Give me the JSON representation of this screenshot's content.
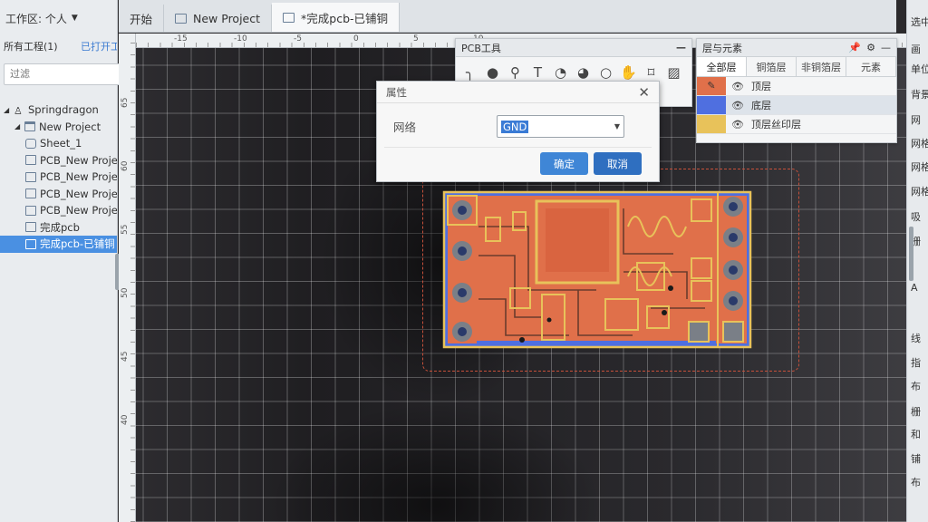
{
  "left_panel": {
    "workspace_label": "工作区: 个人",
    "projects_label": "所有工程(1)",
    "opened_label": "已打开工",
    "filter_placeholder": "过滤",
    "tree": [
      {
        "label": "Springdragon",
        "level": 0,
        "icon": "user-icon",
        "selected": false
      },
      {
        "label": "New Project",
        "level": 1,
        "icon": "folder-icon",
        "selected": false
      },
      {
        "label": "Sheet_1",
        "level": 2,
        "icon": "schematic-icon",
        "selected": false
      },
      {
        "label": "PCB_New Project",
        "level": 2,
        "icon": "pcb-icon",
        "selected": false
      },
      {
        "label": "PCB_New Project",
        "level": 2,
        "icon": "pcb-icon",
        "selected": false
      },
      {
        "label": "PCB_New Project",
        "level": 2,
        "icon": "pcb-icon",
        "selected": false
      },
      {
        "label": "PCB_New Project",
        "level": 2,
        "icon": "pcb-icon",
        "selected": false
      },
      {
        "label": "完成pcb",
        "level": 2,
        "icon": "pcb-icon",
        "selected": false
      },
      {
        "label": "完成pcb-已铺铜",
        "level": 2,
        "icon": "pcb-icon",
        "selected": true
      }
    ]
  },
  "tabs": [
    {
      "label": "开始",
      "icon": "",
      "active": false
    },
    {
      "label": "New Project",
      "icon": "folder-icon",
      "active": false
    },
    {
      "label": "*完成pcb-已铺铜",
      "icon": "pcb-icon",
      "active": true
    }
  ],
  "rulers": {
    "top": [
      "-15",
      "-10",
      "-5",
      "0",
      "5",
      "10"
    ],
    "left": [
      "65",
      "60",
      "55",
      "50",
      "45",
      "40"
    ]
  },
  "pcb_tools": {
    "title": "PCB工具",
    "minimize": "—",
    "tools": [
      "track-icon",
      "circle-pad-icon",
      "via-icon",
      "text-icon",
      "arc-icon",
      "arc2-icon",
      "circle-icon",
      "pan-icon",
      "measure-icon",
      "image-icon"
    ]
  },
  "layers_panel": {
    "title": "层与元素",
    "tabs": [
      "全部层",
      "铜箔层",
      "非铜箔层",
      "元素"
    ],
    "active_tab": 0,
    "layers": [
      {
        "name": "顶层",
        "color": "#e0704a",
        "selected": false
      },
      {
        "name": "底层",
        "color": "#4f6fe0",
        "selected": true
      },
      {
        "name": "顶层丝印层",
        "color": "#e8c25a",
        "selected": false
      }
    ]
  },
  "dialog": {
    "title": "属性",
    "field_label": "网络",
    "field_value": "GND",
    "ok_label": "确定",
    "cancel_label": "取消"
  },
  "right_panel": {
    "items": [
      "选中",
      "画",
      "单位",
      "背景",
      "网",
      "网格",
      "网格",
      "网格",
      "吸",
      "栅",
      "A",
      "线",
      "指",
      "布",
      "栅",
      "和",
      "铺",
      "布"
    ]
  },
  "colors": {
    "copper_top": "#e0704a",
    "copper_bottom": "#4f6fe0",
    "silk": "#e8c25a",
    "accent": "#3f86d6"
  }
}
